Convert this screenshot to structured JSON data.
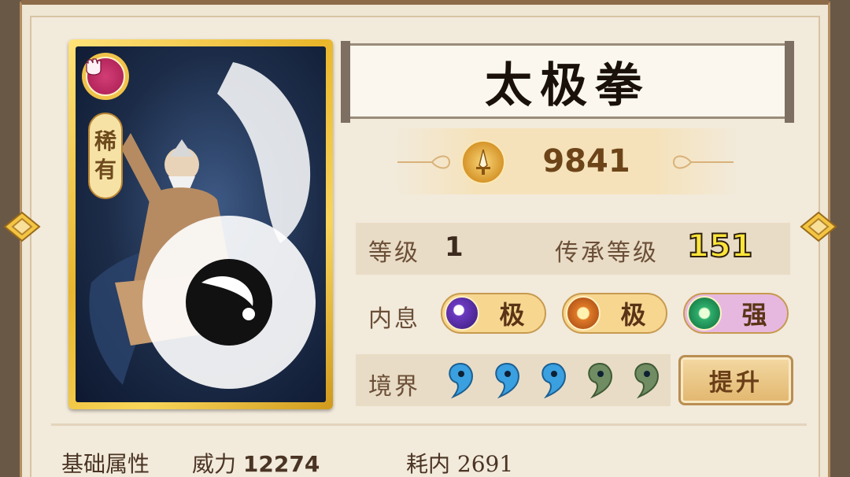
{
  "skill": {
    "name": "太极拳",
    "rarity_chars": [
      "稀",
      "有"
    ],
    "power": "9841"
  },
  "stats": {
    "level_label": "等级",
    "level_value": "1",
    "inherit_label": "传承等级",
    "inherit_value": "151",
    "inner_label": "内息",
    "inner_pills": [
      {
        "text": "极",
        "gem_color": "#6a3ac0",
        "bg": "#f7d690"
      },
      {
        "text": "极",
        "gem_color": "#e07a28",
        "bg": "#f7d690"
      },
      {
        "text": "强",
        "gem_color": "#2fae6c",
        "bg": "#e6b8e0"
      }
    ],
    "realm_label": "境界",
    "realm_levels_filled": 3,
    "realm_levels_total": 5,
    "upgrade_label": "提升"
  },
  "base": {
    "section_label": "基础属性",
    "power_label": "威力",
    "power_value": "12274",
    "cost_label": "耗内",
    "cost_value": "2691"
  },
  "icons": {
    "card_emblem": "fist-icon",
    "power_icon": "sword-icon",
    "prev": "arrow-left-icon",
    "next": "arrow-right-icon"
  },
  "colors": {
    "card_gold": "#e9b62b",
    "drop_filled": "#3aa0e0",
    "drop_empty": "#6f8c62",
    "inherit_yellow": "#ffe53a"
  }
}
